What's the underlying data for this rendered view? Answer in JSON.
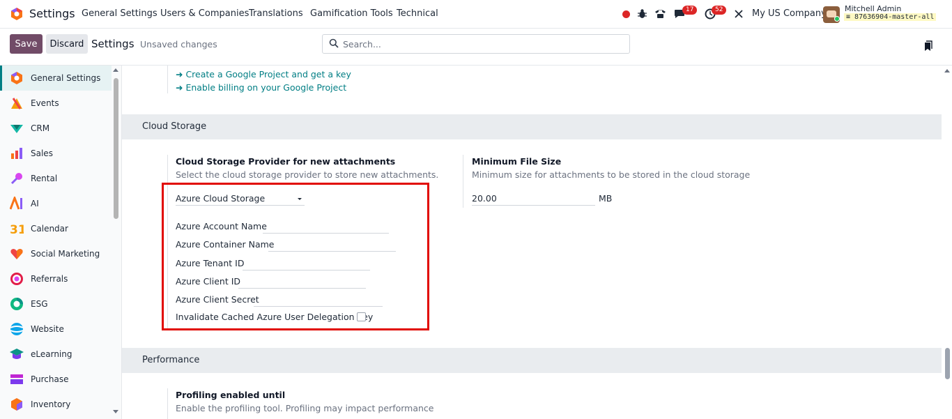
{
  "navbar": {
    "app_name": "Settings",
    "menu": [
      "General Settings",
      "Users & Companies",
      "Translations",
      "Gamification Tools",
      "Technical"
    ],
    "chat_badge": "17",
    "activity_badge": "52",
    "company": "My US Company",
    "user_name": "Mitchell Admin",
    "db_name": "87636904-master-all"
  },
  "control_panel": {
    "save_label": "Save",
    "discard_label": "Discard",
    "breadcrumb": "Settings",
    "unsaved": "Unsaved changes",
    "search_placeholder": "Search..."
  },
  "sidebar": {
    "items": [
      {
        "label": "General Settings",
        "icon": "settings-app-icon",
        "color": "#e05a3a"
      },
      {
        "label": "Events",
        "icon": "events-app-icon",
        "color": "#f59e0b"
      },
      {
        "label": "CRM",
        "icon": "crm-app-icon",
        "color": "#14b8a6"
      },
      {
        "label": "Sales",
        "icon": "sales-app-icon",
        "color": "#ef4444"
      },
      {
        "label": "Rental",
        "icon": "rental-app-icon",
        "color": "#d946ef"
      },
      {
        "label": "AI",
        "icon": "ai-app-icon",
        "color": "#8b5cf6"
      },
      {
        "label": "Calendar",
        "icon": "calendar-app-icon",
        "color": "#f59e0b"
      },
      {
        "label": "Social Marketing",
        "icon": "social-marketing-app-icon",
        "color": "#ef4444"
      },
      {
        "label": "Referrals",
        "icon": "referrals-app-icon",
        "color": "#e11d48"
      },
      {
        "label": "ESG",
        "icon": "esg-app-icon",
        "color": "#10b981"
      },
      {
        "label": "Website",
        "icon": "website-app-icon",
        "color": "#0ea5e9"
      },
      {
        "label": "eLearning",
        "icon": "elearning-app-icon",
        "color": "#0d9488"
      },
      {
        "label": "Purchase",
        "icon": "purchase-app-icon",
        "color": "#c026d3"
      },
      {
        "label": "Inventory",
        "icon": "inventory-app-icon",
        "color": "#f97316"
      }
    ]
  },
  "main": {
    "links": [
      "➜ Create a Google Project and get a key",
      "➜ Enable billing on your Google Project"
    ],
    "cloud_storage": {
      "section_title": "Cloud Storage",
      "provider_title": "Cloud Storage Provider for new attachments",
      "provider_desc": "Select the cloud storage provider to store new attachments.",
      "provider_value": "Azure Cloud Storage",
      "fields": [
        "Azure Account Name",
        "Azure Container Name",
        "Azure Tenant ID",
        "Azure Client ID",
        "Azure Client Secret"
      ],
      "invalidate_label": "Invalidate Cached Azure User Delegation Key",
      "min_size_title": "Minimum File Size",
      "min_size_desc": "Minimum size for attachments to be stored in the cloud storage",
      "min_size_value": "20.00",
      "min_size_unit": "MB"
    },
    "performance": {
      "section_title": "Performance",
      "profiling_title": "Profiling enabled until",
      "profiling_desc": "Enable the profiling tool. Profiling may impact performance"
    }
  }
}
